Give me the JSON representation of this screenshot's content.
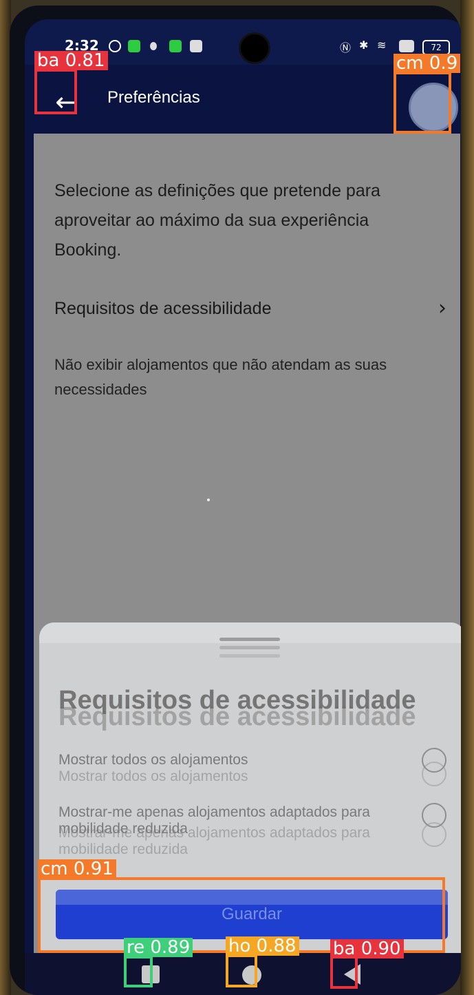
{
  "status_bar": {
    "time": "2:32",
    "battery": "72"
  },
  "app_bar": {
    "title": "Preferências",
    "back_icon": "arrow-left-icon",
    "avatar_icon": "profile-avatar-icon"
  },
  "main": {
    "intro_text": "Selecione as definições que pretende para aproveitar ao máximo da sua experiência Booking.",
    "accessibility": {
      "title": "Requisitos de acessibilidade",
      "description": "Não exibir alojamentos que não atendam as suas necessidades",
      "chevron_icon": "chevron-right-icon"
    }
  },
  "sheet": {
    "title": "Requisitos de acessibilidade",
    "options": [
      {
        "label": "Mostrar todos os alojamentos"
      },
      {
        "label": "Mostrar-me apenas alojamentos adaptados para mobilidade reduzida"
      }
    ],
    "save_label": "Guardar"
  },
  "nav_bar": {
    "recents_icon": "square-icon",
    "home_icon": "circle-icon",
    "back_icon": "triangle-back-icon"
  },
  "detections": [
    {
      "label": "ba 0.81",
      "color": "#e8323c"
    },
    {
      "label": "cm 0.9",
      "color": "#f47a2a"
    },
    {
      "label": "cm 0.91",
      "color": "#f47a2a"
    },
    {
      "label": "re 0.89",
      "color": "#3ecf7a"
    },
    {
      "label": "ho 0.88",
      "color": "#f5a623"
    },
    {
      "label": "ba 0.90",
      "color": "#e8323c"
    }
  ],
  "colors": {
    "app_bar": "#0b1440",
    "button": "#1f3fd0"
  }
}
